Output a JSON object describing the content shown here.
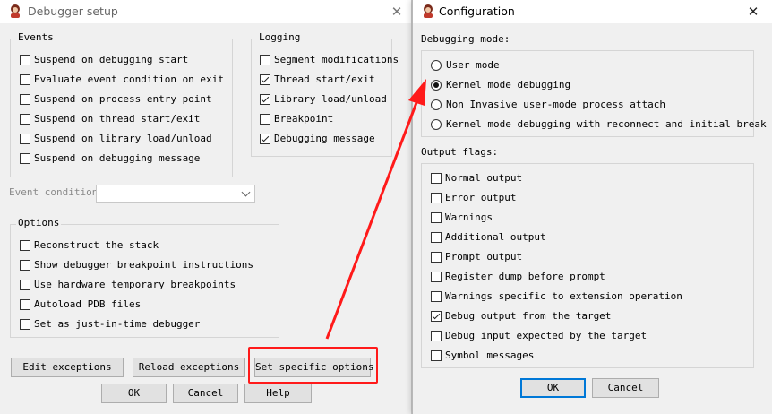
{
  "debugger_setup": {
    "title": "Debugger setup",
    "events_group": {
      "label": "Events",
      "items": [
        {
          "label": "Suspend on debugging start",
          "checked": false
        },
        {
          "label": "Evaluate event condition on exit",
          "checked": false
        },
        {
          "label": "Suspend on process entry point",
          "checked": false
        },
        {
          "label": "Suspend on thread start/exit",
          "checked": false
        },
        {
          "label": "Suspend on library load/unload",
          "checked": false
        },
        {
          "label": "Suspend on debugging message",
          "checked": false
        }
      ]
    },
    "logging_group": {
      "label": "Logging",
      "items": [
        {
          "label": "Segment modifications",
          "checked": false
        },
        {
          "label": "Thread start/exit",
          "checked": true
        },
        {
          "label": "Library load/unload",
          "checked": true
        },
        {
          "label": "Breakpoint",
          "checked": false
        },
        {
          "label": "Debugging message",
          "checked": true
        }
      ]
    },
    "event_condition": {
      "label": "Event condition",
      "value": ""
    },
    "options_group": {
      "label": "Options",
      "items": [
        {
          "label": "Reconstruct the stack",
          "checked": false
        },
        {
          "label": "Show debugger breakpoint instructions",
          "checked": false
        },
        {
          "label": "Use hardware temporary breakpoints",
          "checked": false
        },
        {
          "label": "Autoload PDB files",
          "checked": false
        },
        {
          "label": "Set as just-in-time debugger",
          "checked": false
        }
      ]
    },
    "buttons": {
      "edit_exceptions": "Edit exceptions",
      "reload_exceptions": "Reload exceptions",
      "set_specific_options": "Set specific options",
      "ok": "OK",
      "cancel": "Cancel",
      "help": "Help"
    }
  },
  "configuration": {
    "title": "Configuration",
    "debugging_mode_label": "Debugging mode:",
    "modes": [
      {
        "label": "User mode",
        "selected": false
      },
      {
        "label": "Kernel mode debugging",
        "selected": true
      },
      {
        "label": "Non Invasive user-mode process attach",
        "selected": false
      },
      {
        "label": "Kernel mode debugging with reconnect and initial break",
        "selected": false
      }
    ],
    "output_flags_label": "Output flags:",
    "flags": [
      {
        "label": "Normal output",
        "checked": false
      },
      {
        "label": "Error output",
        "checked": false
      },
      {
        "label": "Warnings",
        "checked": false
      },
      {
        "label": "Additional output",
        "checked": false
      },
      {
        "label": "Prompt output",
        "checked": false
      },
      {
        "label": "Register dump before prompt",
        "checked": false
      },
      {
        "label": "Warnings specific to extension operation",
        "checked": false
      },
      {
        "label": "Debug output from the target",
        "checked": true
      },
      {
        "label": "Debug input expected by the target",
        "checked": false
      },
      {
        "label": "Symbol messages",
        "checked": false
      }
    ],
    "buttons": {
      "ok": "OK",
      "cancel": "Cancel"
    }
  },
  "colors": {
    "annotation": "#ff1a1a",
    "window_bg": "#f0f0f0",
    "accent": "#0078d7"
  },
  "icons": {
    "app": "ida-app-icon",
    "close": "close-icon"
  }
}
